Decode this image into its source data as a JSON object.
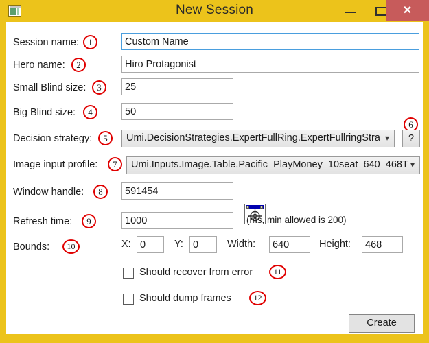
{
  "window": {
    "title": "New Session",
    "app_icon": "app-window-icon",
    "controls": {
      "minimize": "minimize-icon",
      "maximize": "maximize-icon",
      "close_label": "✕"
    }
  },
  "form": {
    "rows": [
      {
        "label": "Session name:",
        "marker": "1",
        "value": "Custom Name"
      },
      {
        "label": "Hero name:",
        "marker": "2",
        "value": "Hiro Protagonist"
      },
      {
        "label": "Small Blind size:",
        "marker": "3",
        "value": "25"
      },
      {
        "label": "Big Blind size:",
        "marker": "4",
        "value": "50"
      },
      {
        "label": "Decision strategy:",
        "marker": "5",
        "value": "Umi.DecisionStrategies.ExpertFullRing.ExpertFullringStra"
      },
      {
        "label": "Image input profile:",
        "marker": "7",
        "value": "Umi.Inputs.Image.Table.Pacific_PlayMoney_10seat_640_468T"
      },
      {
        "label": "Window handle:",
        "marker": "8",
        "value": "591454"
      },
      {
        "label": "Refresh time:",
        "marker": "9",
        "value": "1000"
      },
      {
        "label": "Bounds:",
        "marker": "10"
      }
    ],
    "help_button": {
      "label": "?",
      "marker": "6"
    },
    "window_picker": "crosshair-target-icon",
    "refresh_hint": "(ms, min allowed is 200)",
    "bounds": [
      {
        "label": "X:",
        "value": "0"
      },
      {
        "label": "Y:",
        "value": "0"
      },
      {
        "label": "Width:",
        "value": "640"
      },
      {
        "label": "Height:",
        "value": "468"
      }
    ],
    "checkboxes": [
      {
        "label": "Should recover from error",
        "marker": "11",
        "checked": false
      },
      {
        "label": "Should dump frames",
        "marker": "12",
        "checked": false
      }
    ],
    "create_label": "Create"
  },
  "colors": {
    "chrome": "#ecc31b",
    "close_button": "#c75b5b",
    "marker_ring": "#e00000",
    "focus_border": "#4a9ede"
  }
}
